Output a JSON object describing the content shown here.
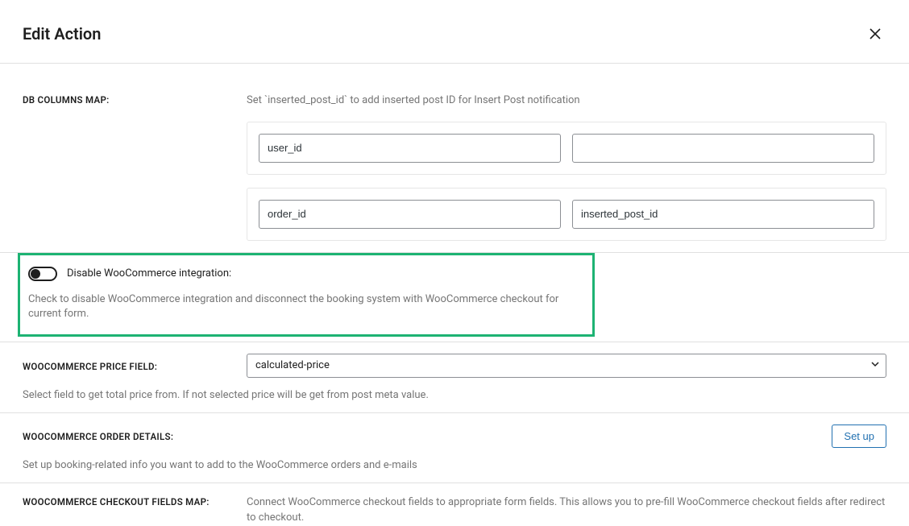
{
  "header": {
    "title": "Edit Action"
  },
  "dbColumns": {
    "label": "DB COLUMNS MAP:",
    "help": "Set `inserted_post_id` to add inserted post ID for Insert Post notification",
    "rows": [
      {
        "key": "user_id",
        "value": ""
      },
      {
        "key": "order_id",
        "value": "inserted_post_id"
      }
    ]
  },
  "disableWoo": {
    "label": "Disable WooCommerce integration:",
    "enabled": false,
    "help": "Check to disable WooCommerce integration and disconnect the booking system with WooCommerce checkout for current form."
  },
  "priceField": {
    "label": "WOOCOMMERCE PRICE FIELD:",
    "value": "calculated-price",
    "help": "Select field to get total price from. If not selected price will be get from post meta value."
  },
  "orderDetails": {
    "label": "WOOCOMMERCE ORDER DETAILS:",
    "button": "Set up",
    "help": "Set up booking-related info you want to add to the WooCommerce orders and e-mails"
  },
  "checkoutMap": {
    "label": "WOOCOMMERCE CHECKOUT FIELDS MAP:",
    "help": "Connect WooCommerce checkout fields to appropriate form fields. This allows you to pre-fill WooCommerce checkout fields after redirect to checkout."
  }
}
